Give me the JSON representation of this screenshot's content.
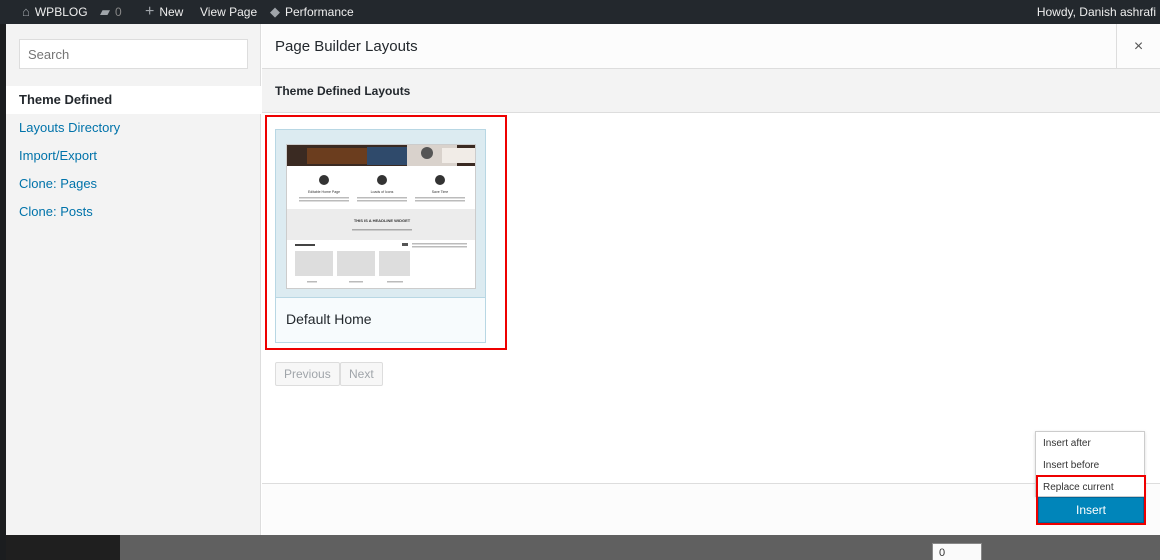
{
  "adminbar": {
    "site_name": "WPBLOG",
    "comments_count": "0",
    "new_label": "New",
    "view_page_label": "View Page",
    "performance_label": "Performance",
    "greeting": "Howdy, Danish ashrafi"
  },
  "modal": {
    "title": "Page Builder Layouts",
    "close": "×",
    "subheader": "Theme Defined Layouts"
  },
  "sidebar": {
    "search_placeholder": "Search",
    "items": [
      {
        "label": "Theme Defined",
        "active": true
      },
      {
        "label": "Layouts Directory",
        "active": false
      },
      {
        "label": "Import/Export",
        "active": false
      },
      {
        "label": "Clone: Pages",
        "active": false
      },
      {
        "label": "Clone: Posts",
        "active": false
      }
    ]
  },
  "layouts": [
    {
      "name": "Default Home"
    }
  ],
  "thumbnail": {
    "headline": "THIS IS A HEADLINE WIDGET",
    "col_titles": [
      "Editable Home Page",
      "Loads of Icons",
      "Save Time"
    ]
  },
  "pagination": {
    "previous": "Previous",
    "next": "Next"
  },
  "insert_menu": {
    "options": [
      "Insert after",
      "Insert before",
      "Replace current"
    ],
    "button": "Insert"
  },
  "background": {
    "field_value": "0"
  },
  "colors": {
    "accent": "#0085ba",
    "highlight": "#e00000",
    "link": "#0073aa"
  }
}
